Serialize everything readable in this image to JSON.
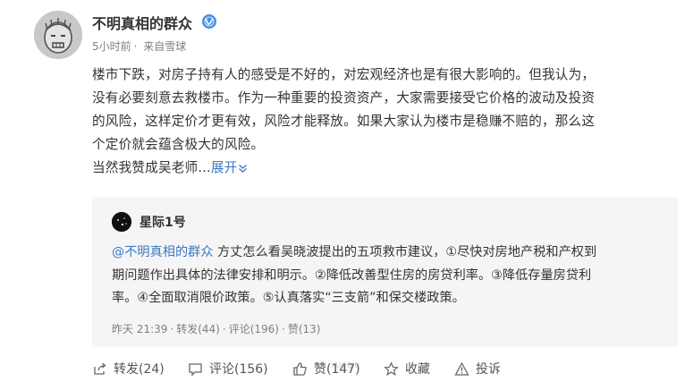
{
  "post": {
    "author": "不明真相的群众",
    "time": "5小时前",
    "source": "来自雪球",
    "text_lines": [
      "楼市下跌，对房子持有人的感受是不好的，对宏观经济也是有很大影响的。但我认为，",
      "没有必要刻意去救楼市。作为一种重要的投资资产，大家需要接受它价格的波动及投资",
      "的风险，这样定价才更有效，风险才能释放。如果大家认为楼市是稳赚不赔的，那么这",
      "个定价就会蕴含极大的风险。"
    ],
    "last_line": "当然我赞成吴老师...",
    "expand_label": "展开"
  },
  "repost": {
    "author": "星际1号",
    "mention": "@不明真相的群众",
    "text_first": " 方丈怎么看吴晓波提出的五项救市建议，①尽快对房地产税和产权到",
    "text_lines": [
      "期问题作出具体的法律安排和明示。②降低改善型住房的房贷利率。③降低存量房贷利",
      "率。④全面取消限价政策。⑤认真落实“三支箭”和保交楼政策。"
    ],
    "time": "昨天 21:39",
    "repost_count": "转发(44)",
    "comment_count": "评论(196)",
    "like_count": "赞(13)"
  },
  "actions": {
    "repost": "转发(24)",
    "comment": "评论(156)",
    "like": "赞(147)",
    "favorite": "收藏",
    "report": "投诉"
  },
  "watermark": "xueqiu",
  "icons": {
    "verified": "verified-badge-icon",
    "expand": "chevron-double-down-icon",
    "repost": "share-icon",
    "comment": "comment-icon",
    "like": "thumbs-up-icon",
    "favorite": "star-icon",
    "report": "warning-icon"
  },
  "colors": {
    "link": "#3b7ac4",
    "badge": "#4a90e2",
    "repost_bg": "#f5f5f5",
    "meta": "#808080"
  }
}
